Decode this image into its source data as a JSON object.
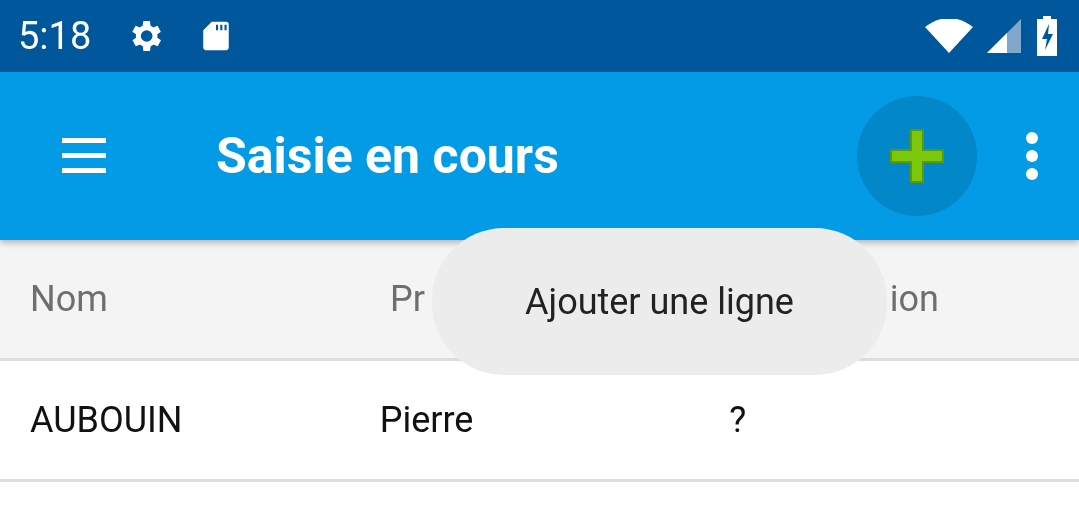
{
  "status_bar": {
    "time": "5:18"
  },
  "toolbar": {
    "title": "Saisie en cours"
  },
  "table": {
    "columns": [
      "Nom",
      "Pr",
      "ion"
    ],
    "rows": [
      [
        "AUBOUIN",
        "Pierre",
        "?"
      ]
    ]
  },
  "tooltip": {
    "text": "Ajouter une ligne"
  }
}
